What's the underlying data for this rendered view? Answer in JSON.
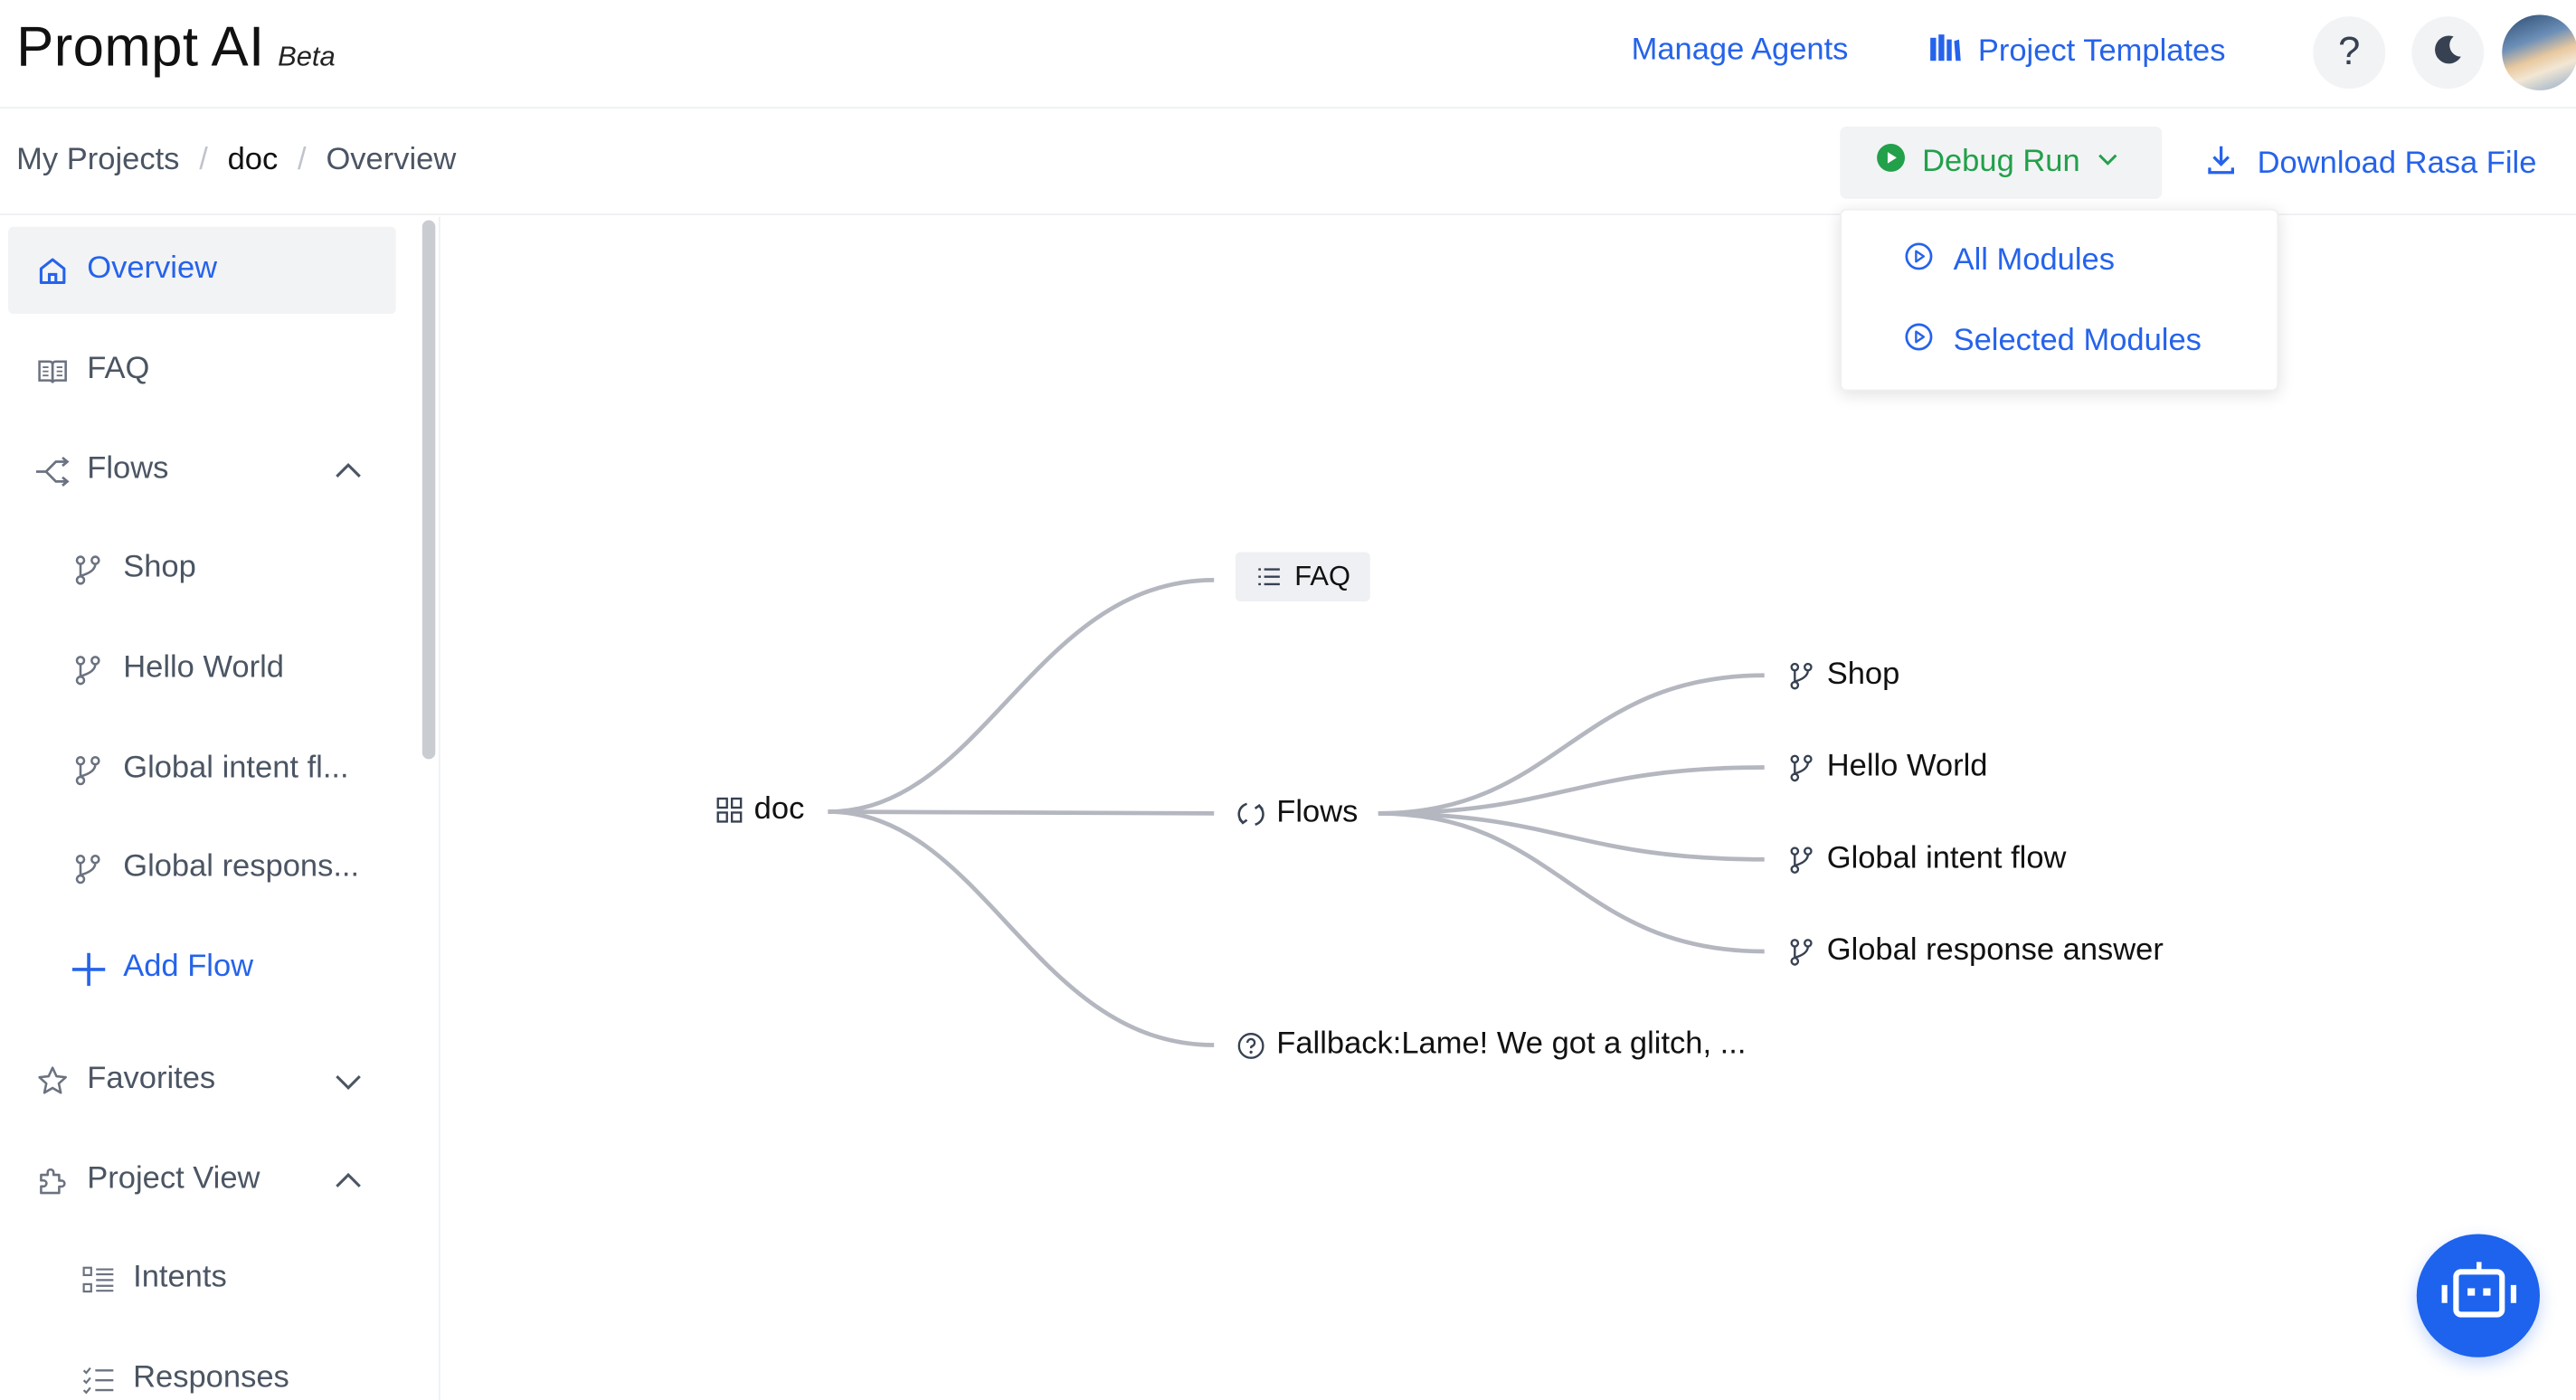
{
  "header": {
    "brand": "Prompt AI",
    "badge": "Beta",
    "manage_agents": "Manage Agents",
    "project_templates": "Project Templates",
    "help_glyph": "?"
  },
  "breadcrumb": {
    "items": [
      "My Projects",
      "doc",
      "Overview"
    ],
    "separator": "/"
  },
  "actions": {
    "debug_run": "Debug Run",
    "download": "Download Rasa File",
    "debug_menu": [
      "All Modules",
      "Selected Modules"
    ]
  },
  "sidebar": {
    "overview": "Overview",
    "faq": "FAQ",
    "flows": "Flows",
    "flow_items": [
      "Shop",
      "Hello World",
      "Global intent fl...",
      "Global respons..."
    ],
    "add_flow": "Add Flow",
    "favorites": "Favorites",
    "project_view": "Project View",
    "project_items": [
      "Intents",
      "Responses"
    ]
  },
  "mindmap": {
    "root": "doc",
    "faq": "FAQ",
    "flows": "Flows",
    "fallback": "Fallback:Lame! We got a glitch, ...",
    "flow_children": [
      "Shop",
      "Hello World",
      "Global intent flow",
      "Global response answer"
    ]
  },
  "colors": {
    "accent": "#2563eb",
    "debug_green": "#22a04a",
    "fab": "#1d63ed",
    "edge": "#b4b7bf",
    "active_bg": "#f2f3f5"
  },
  "icons": {
    "overview": "home-icon",
    "faq": "book-icon",
    "flows": "flow-icon",
    "flow_item": "branch-icon",
    "favorites": "star-icon",
    "project_view": "puzzle-icon",
    "intents": "intents-icon",
    "responses": "list-icon",
    "fab": "robot-icon"
  }
}
